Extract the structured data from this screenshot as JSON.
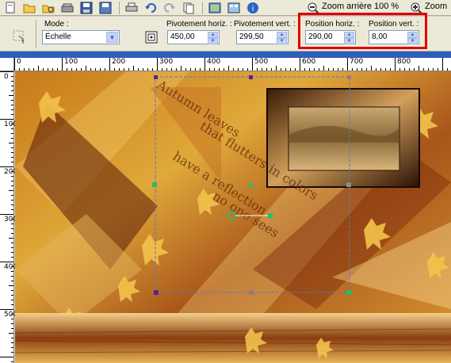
{
  "toolbar": {
    "icons": [
      "new-icon",
      "open-icon",
      "browse-icon",
      "scan-icon",
      "save-icon",
      "print-icon",
      "undo-icon",
      "redo-icon",
      "copy-icon",
      "view-icon",
      "help-icon",
      "zoom-out-icon",
      "zoom-icon"
    ],
    "zoom_out_label": "Zoom arrière 100 %",
    "zoom_label": "Zoom"
  },
  "options": {
    "mode_label": "Mode :",
    "mode_value": "Échelle",
    "rot_h_label": "Pivotement horiz. :",
    "rot_h_value": "450,00",
    "rot_v_label": "Pivotement vert. :",
    "rot_v_value": "299,50",
    "pos_h_label": "Position horiz. :",
    "pos_h_value": "290,00",
    "pos_v_label": "Position vert. :",
    "pos_v_value": "8,00"
  },
  "ruler": {
    "h_labels": [
      "0",
      "100",
      "200",
      "300",
      "400",
      "500",
      "600",
      "700",
      "800"
    ],
    "v_labels": [
      "0",
      "100",
      "200",
      "300",
      "400",
      "500"
    ]
  },
  "canvas": {
    "text_lines": [
      "Autumn leaves",
      "that flutters in colors",
      "have a reflection",
      "no one sees"
    ]
  }
}
